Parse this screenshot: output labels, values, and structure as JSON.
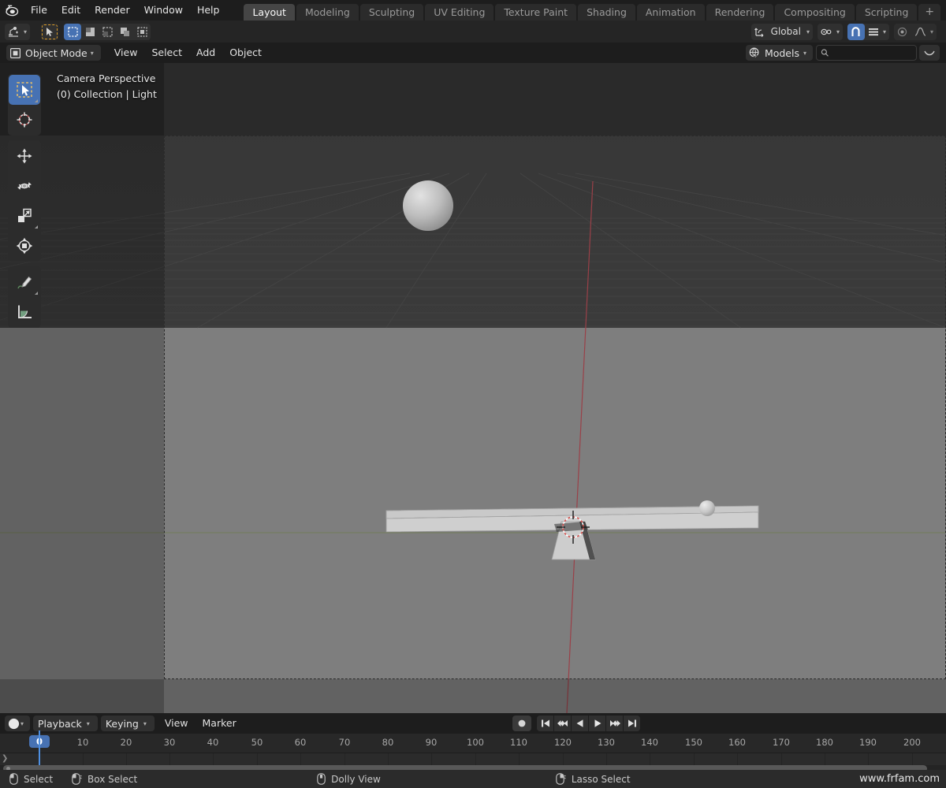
{
  "app": {
    "title": "Blender",
    "logo_icon": "blender-logo-icon"
  },
  "topbar": {
    "menus": [
      {
        "label": "File"
      },
      {
        "label": "Edit"
      },
      {
        "label": "Render"
      },
      {
        "label": "Window"
      },
      {
        "label": "Help"
      }
    ],
    "workspace_tabs": [
      {
        "label": "Layout",
        "active": true
      },
      {
        "label": "Modeling",
        "active": false
      },
      {
        "label": "Sculpting",
        "active": false
      },
      {
        "label": "UV Editing",
        "active": false
      },
      {
        "label": "Texture Paint",
        "active": false
      },
      {
        "label": "Shading",
        "active": false
      },
      {
        "label": "Animation",
        "active": false
      },
      {
        "label": "Rendering",
        "active": false
      },
      {
        "label": "Compositing",
        "active": false
      },
      {
        "label": "Scripting",
        "active": false
      }
    ],
    "add_workspace_label": "+"
  },
  "tool_header": {
    "editor_type_icon": "editor-type-icon",
    "cursor_tool_icon": "tweak-cursor-icon",
    "select_modes": [
      {
        "icon": "select-set-icon",
        "active": true
      },
      {
        "icon": "select-extend-icon",
        "active": false
      },
      {
        "icon": "select-subtract-icon",
        "active": false
      },
      {
        "icon": "select-invert-icon",
        "active": false
      },
      {
        "icon": "select-intersect-icon",
        "active": false
      }
    ],
    "transform_orientation": {
      "icon": "orientation-icon",
      "label": "Global"
    },
    "snap": {
      "icon": "snap-magnet-icon",
      "enabled": true,
      "target_icon": "snap-target-icon"
    },
    "pivot": {
      "icon": "pivot-point-icon"
    },
    "proportional": {
      "icon": "proportional-edit-icon",
      "falloff_icon": "falloff-curve-icon"
    }
  },
  "viewport_header": {
    "mode": {
      "icon": "object-mode-icon",
      "label": "Object Mode"
    },
    "menus": [
      {
        "label": "View"
      },
      {
        "label": "Select"
      },
      {
        "label": "Add"
      },
      {
        "label": "Object"
      }
    ],
    "asset_library": {
      "icon": "globe-cursor-icon",
      "label": "Models"
    },
    "search": {
      "icon": "search-icon",
      "value": "",
      "placeholder": ""
    },
    "options_dropdown_icon": "chevron-down-icon"
  },
  "viewport": {
    "overlay_line1": "Camera Perspective",
    "overlay_line2": "(0) Collection | Light",
    "toolbar": [
      {
        "icon": "tweak-select-box-icon",
        "name": "select-box-tool",
        "active": true
      },
      {
        "icon": "cursor-3d-icon",
        "name": "cursor-tool",
        "active": false
      },
      {
        "icon": "move-tool-icon",
        "name": "move-tool",
        "active": false
      },
      {
        "icon": "rotate-tool-icon",
        "name": "rotate-tool",
        "active": false
      },
      {
        "icon": "scale-tool-icon",
        "name": "scale-tool",
        "active": false
      },
      {
        "icon": "transform-tool-icon",
        "name": "transform-tool",
        "active": false
      },
      {
        "icon": "annotate-tool-icon",
        "name": "annotate-tool",
        "active": false
      },
      {
        "icon": "measure-tool-icon",
        "name": "measure-tool",
        "active": false
      }
    ],
    "scene_objects": [
      {
        "name": "sphere-large",
        "type": "uv-sphere"
      },
      {
        "name": "plank",
        "type": "lever-plank"
      },
      {
        "name": "wedge-fulcrum",
        "type": "fulcrum"
      },
      {
        "name": "sphere-small",
        "type": "ball"
      },
      {
        "name": "cursor-3d",
        "type": "3d-cursor"
      }
    ],
    "colors": {
      "sky": "#383838",
      "ground": "#7e7e7e",
      "axis_y": "#8a3a3f",
      "axis_x": "#6d7d4a",
      "object_grey": "#c4c4c4"
    }
  },
  "timeline": {
    "editor_icon": "timeline-editor-icon",
    "menus": [
      {
        "label": "Playback",
        "dropdown": true
      },
      {
        "label": "Keying",
        "dropdown": true
      },
      {
        "label": "View",
        "dropdown": false
      },
      {
        "label": "Marker",
        "dropdown": false
      }
    ],
    "playback_controls": [
      {
        "icon": "record-icon",
        "name": "auto-keying-toggle"
      },
      {
        "icon": "jump-to-start-icon",
        "name": "jump-to-start-button"
      },
      {
        "icon": "prev-keyframe-icon",
        "name": "prev-keyframe-button"
      },
      {
        "icon": "play-reverse-icon",
        "name": "play-reverse-button"
      },
      {
        "icon": "play-icon",
        "name": "play-button"
      },
      {
        "icon": "next-keyframe-icon",
        "name": "next-keyframe-button"
      },
      {
        "icon": "jump-to-end-icon",
        "name": "jump-to-end-button"
      }
    ],
    "current_frame": "0",
    "ticks": [
      "0",
      "10",
      "20",
      "30",
      "40",
      "50",
      "60",
      "70",
      "80",
      "90",
      "100",
      "110",
      "120",
      "130",
      "140",
      "150",
      "160",
      "170",
      "180",
      "190",
      "200"
    ]
  },
  "statusbar": {
    "items": [
      {
        "icon": "mouse-left-icon",
        "label": "Select"
      },
      {
        "icon": "mouse-left-drag-icon",
        "label": "Box Select"
      },
      {
        "icon": "mouse-middle-icon",
        "label": "Dolly View"
      },
      {
        "icon": "mouse-right-icon",
        "label": "Lasso Select"
      }
    ],
    "watermark": "www.frfam.com"
  }
}
